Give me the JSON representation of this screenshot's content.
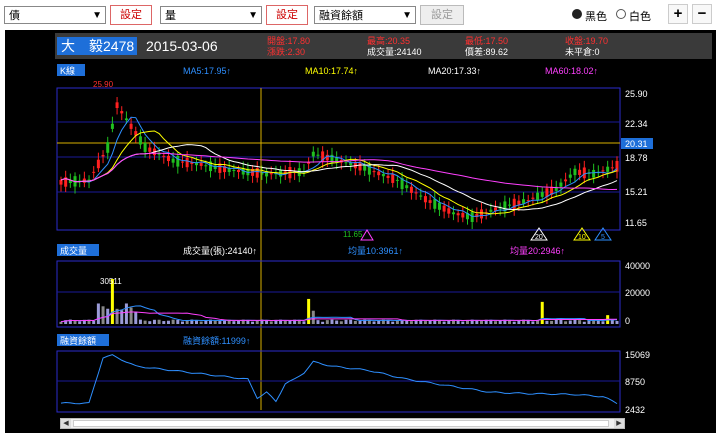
{
  "toolbar": {
    "select1": "債",
    "select2": "量",
    "select3": "融資餘額",
    "set_label": "設定",
    "radio_black": "黑色",
    "radio_white": "白色",
    "plus": "+",
    "minus": "−"
  },
  "header": {
    "stock_name": "大　毅",
    "stock_code": "2478",
    "date": "2015-03-06",
    "open_label": "開盤:17.80",
    "change_label": "漲跌:2.30",
    "high_label": "最高:20.35",
    "volume_label": "成交量:24140",
    "low_label": "最低:17.50",
    "spread_label": "價差:89.62",
    "close_label": "收盤:19.70",
    "unsettled_label": "未平倉:0"
  },
  "kline": {
    "panel_title": "K線",
    "ma5": "MA5:17.95↑",
    "ma10": "MA10:17.74↑",
    "ma20": "MA20:17.33↑",
    "ma60": "MA60:18.02↑",
    "y_ticks": [
      "25.90",
      "22.34",
      "18.78",
      "15.21",
      "11.65"
    ],
    "current_price": "20.31",
    "max_label": "25.90",
    "min_label": "11.65",
    "signals": [
      "20",
      "10",
      "5"
    ],
    "colors": {
      "ma5": "#2e8fff",
      "ma10": "#ffff00",
      "ma20": "#ffffff",
      "ma60": "#ff40ff",
      "up": "#ff2020",
      "down": "#20c020"
    }
  },
  "volume": {
    "panel_title": "成交量",
    "vol_label": "成交量(張):24140↑",
    "ma10_label": "均量10:3961↑",
    "ma20_label": "均量20:2946↑",
    "y_ticks": [
      "40000",
      "20000",
      "0"
    ],
    "peak_label": "30511"
  },
  "margin": {
    "panel_title": "融資餘額",
    "value_label": "融資餘額:11999↑",
    "y_ticks": [
      "15069",
      "8750",
      "2432"
    ]
  }
}
